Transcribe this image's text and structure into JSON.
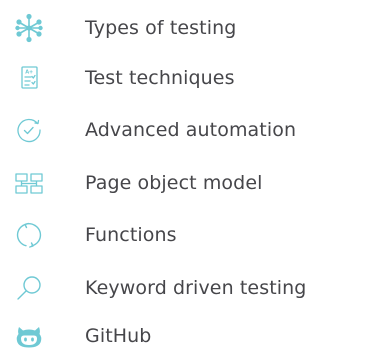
{
  "accent": "#6fc9d4",
  "items": [
    {
      "label": "Types of testing",
      "icon": "snowflake-network-icon"
    },
    {
      "label": "Test techniques",
      "icon": "checklist-document-icon"
    },
    {
      "label": "Advanced automation",
      "icon": "circular-check-arrow-icon"
    },
    {
      "label": "Page object model",
      "icon": "hierarchy-boxes-icon"
    },
    {
      "label": "Functions",
      "icon": "refresh-circle-icon"
    },
    {
      "label": "Keyword driven testing",
      "icon": "magnifier-icon"
    },
    {
      "label": "GitHub",
      "icon": "github-octocat-icon"
    }
  ]
}
